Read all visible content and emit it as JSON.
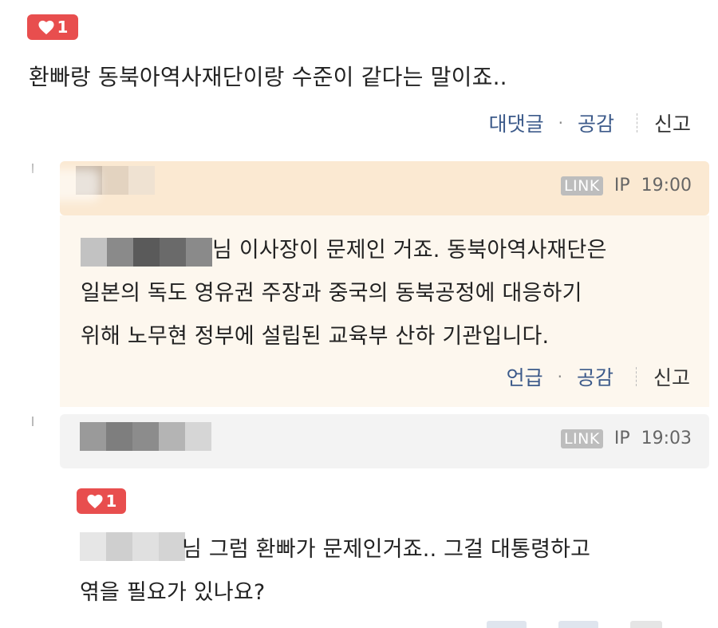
{
  "top_comment": {
    "likes": "1",
    "text": "환빠랑 동북아역사재단이랑 수준이 같다는 말이죠..",
    "actions": {
      "reply": "대댓글",
      "dot": "·",
      "empathy": "공감",
      "report": "신고"
    }
  },
  "reply1": {
    "link_badge": "LINK",
    "ip_label": "IP",
    "time": "19:00",
    "lines": [
      "님 이사장이 문제인 거죠. 동북아역사재단은",
      "일본의 독도 영유권 주장과 중국의 동북공정에 대응하기",
      "위해 노무현 정부에 설립된 교육부 산하 기관입니다."
    ],
    "actions": {
      "mention": "언급",
      "dot": "·",
      "empathy": "공감",
      "report": "신고"
    }
  },
  "reply2": {
    "link_badge": "LINK",
    "ip_label": "IP",
    "time": "19:03",
    "likes": "1",
    "lines": [
      "님 그럼 환빠가 문제인거죠.. 그걸 대통령하고",
      "엮을 필요가 있나요?"
    ]
  },
  "colors": {
    "like_badge": "#e84e4e",
    "reply1_header_bg": "#fbe9d2",
    "reply1_body_bg": "#fdf7ee",
    "reply2_header_bg": "#f3f3f3",
    "action_blue": "#3c5a8a"
  },
  "icons": {
    "heart": "heart-icon"
  }
}
